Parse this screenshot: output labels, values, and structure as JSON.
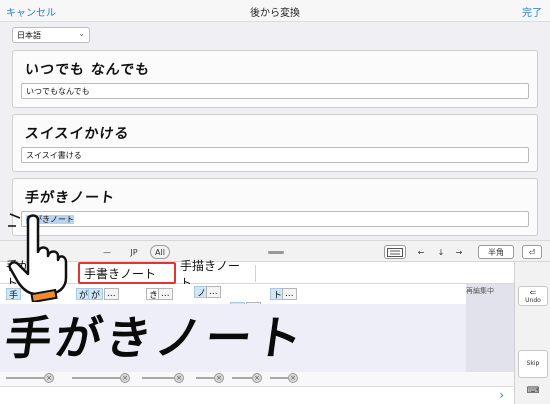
{
  "topbar": {
    "cancel_label": "キャンセル",
    "title": "後から変換",
    "done_label": "完了"
  },
  "language": {
    "selected": "日本語"
  },
  "cards": [
    {
      "handwriting": "いつでも なんでも",
      "text": "いつでもなんでも"
    },
    {
      "handwriting": "スイスイかける",
      "text": "スイスイ書ける"
    },
    {
      "handwriting": "手がきノート",
      "text": "手がきノート"
    }
  ],
  "toolbar": {
    "line_label": "—",
    "jp_label": "JP",
    "all_label": "All",
    "left_arrow": "←",
    "down_arrow": "↓",
    "right_arrow": "→",
    "space_label": "半角",
    "enter_label": "⏎"
  },
  "candidates": [
    "手がきノート",
    "手書きノート",
    "手描きノート"
  ],
  "char_strip": {
    "chars": [
      "手",
      "が",
      "が",
      "き",
      "ノ",
      "ー",
      "ト"
    ],
    "dots": "...",
    "editing_label": "再編集中"
  },
  "canvas": {
    "handwriting": "手がきノート"
  },
  "right_panel": {
    "undo_label": "Undo",
    "skip_label": "Skip"
  },
  "icons": {
    "hand": "pointing-hand-icon",
    "chevron": "chevron-down-icon",
    "next": "chevron-right-icon",
    "keyboard": "keyboard-icon",
    "hide_keyboard": "hide-keyboard-icon",
    "undo": "undo-icon"
  },
  "colors": {
    "accent": "#2d7bd8",
    "highlight": "#e53333",
    "chip_highlight": "#cfe6f7"
  }
}
